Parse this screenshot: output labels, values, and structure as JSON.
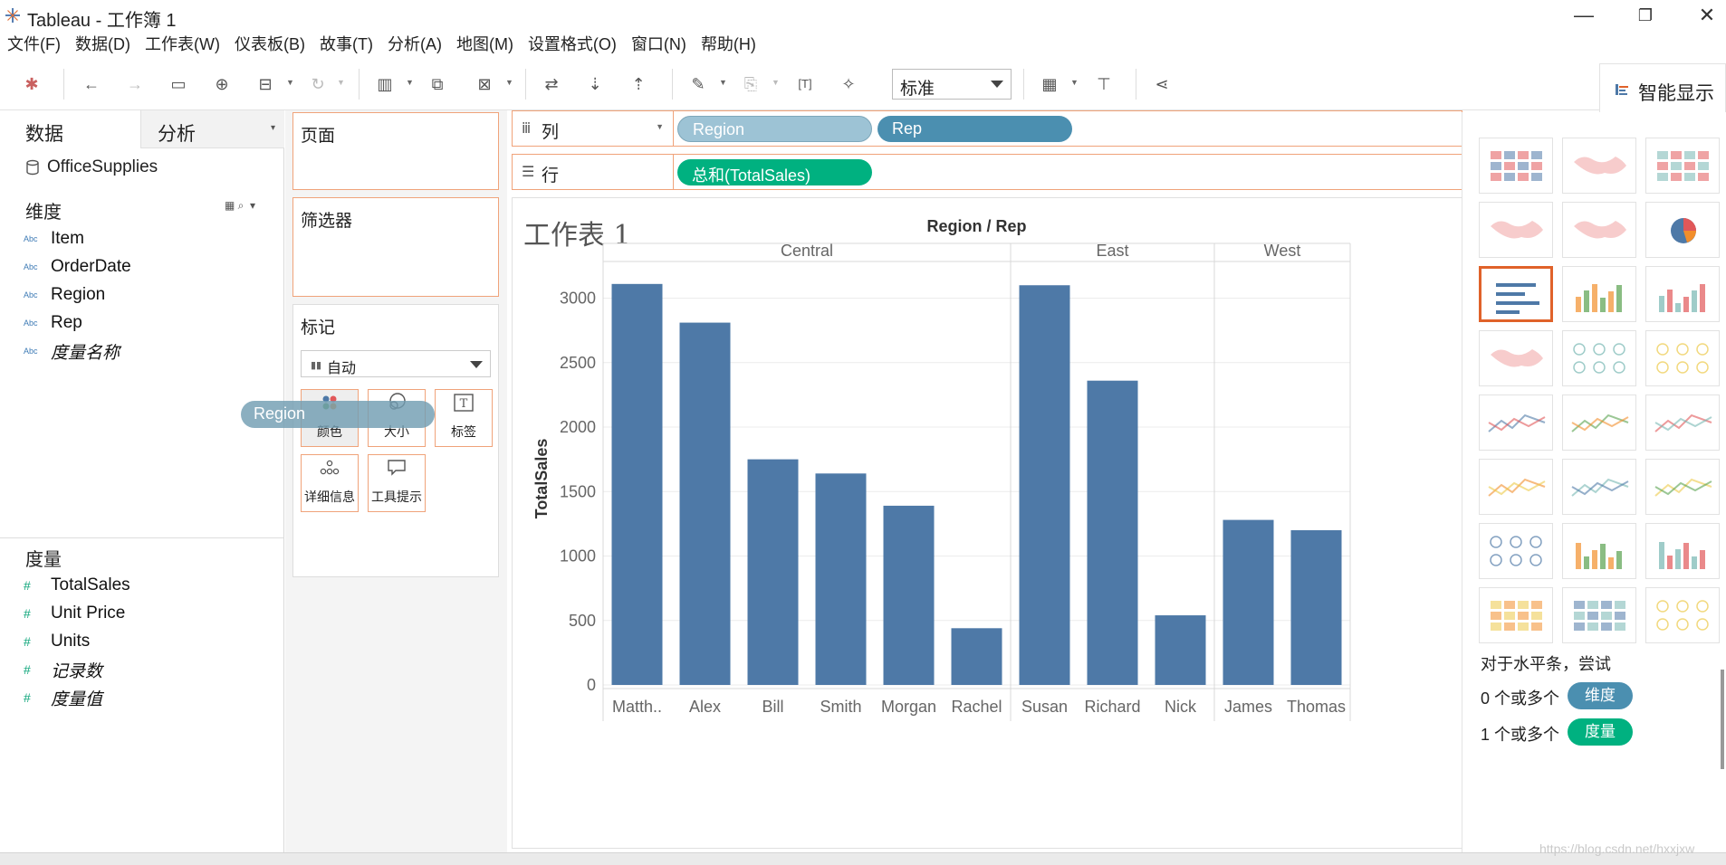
{
  "app": {
    "title": "Tableau - 工作簿 1",
    "window_controls": [
      "—",
      "❐",
      "✕"
    ]
  },
  "menu": [
    "文件(F)",
    "数据(D)",
    "工作表(W)",
    "仪表板(B)",
    "故事(T)",
    "分析(A)",
    "地图(M)",
    "设置格式(O)",
    "窗口(N)",
    "帮助(H)"
  ],
  "toolbar": {
    "fit_select": "标准",
    "smart_show_label": "智能显示"
  },
  "data_pane": {
    "tabs": [
      "数据",
      "分析"
    ],
    "datasource": "OfficeSupplies",
    "dimensions_title": "维度",
    "dimensions": [
      {
        "type": "Abc",
        "name": "Item",
        "italic": false
      },
      {
        "type": "Abc",
        "name": "OrderDate",
        "italic": false
      },
      {
        "type": "Abc",
        "name": "Region",
        "italic": false
      },
      {
        "type": "Abc",
        "name": "Rep",
        "italic": false
      },
      {
        "type": "Abc",
        "name": "度量名称",
        "italic": true
      }
    ],
    "measures_title": "度量",
    "measures": [
      {
        "type": "#",
        "name": "TotalSales",
        "italic": false
      },
      {
        "type": "#",
        "name": "Unit Price",
        "italic": false
      },
      {
        "type": "#",
        "name": "Units",
        "italic": false
      },
      {
        "type": "#",
        "name": "记录数",
        "italic": true
      },
      {
        "type": "#",
        "name": "度量值",
        "italic": true
      }
    ]
  },
  "shelves": {
    "pages_title": "页面",
    "filters_title": "筛选器",
    "marks_title": "标记",
    "marks_type": "自动",
    "mark_buttons": [
      "颜色",
      "大小",
      "标签",
      "详细信息",
      "工具提示"
    ],
    "dragging_pill": "Region",
    "columns_label": "列",
    "rows_label": "行",
    "column_pills": [
      "Region",
      "Rep"
    ],
    "row_pills": [
      "总和(TotalSales)"
    ],
    "colors": {
      "region_pill": "#9dc3d5",
      "rep_pill": "#4b8fb0",
      "measure_pill": "#00b180",
      "accent_border": "#f0a37a"
    }
  },
  "worksheet": {
    "title": "工作表 1"
  },
  "chart_data": {
    "type": "bar",
    "title": "Region / Rep",
    "ylabel": "TotalSales",
    "ylim": [
      0,
      3200
    ],
    "yticks": [
      0,
      500,
      1000,
      1500,
      2000,
      2500,
      3000
    ],
    "bar_color": "#4e79a7",
    "grid": true,
    "groups": [
      {
        "region": "Central",
        "reps": [
          "Matth..",
          "Alex",
          "Bill",
          "Smith",
          "Morgan",
          "Rachel"
        ],
        "values": [
          3110,
          2810,
          1750,
          1640,
          1390,
          440
        ]
      },
      {
        "region": "East",
        "reps": [
          "Susan",
          "Richard",
          "Nick"
        ],
        "values": [
          3100,
          2360,
          540
        ]
      },
      {
        "region": "West",
        "reps": [
          "James",
          "Thomas"
        ],
        "values": [
          1280,
          1200
        ]
      }
    ]
  },
  "smart_show": {
    "hint": "对于水平条，尝试",
    "dim_req": "0 个或多个",
    "dim_badge": "维度",
    "meas_req": "1 个或多个",
    "meas_badge": "度量",
    "selected_index": 6,
    "thumbs": [
      "text-table",
      "heat-map",
      "highlight-table",
      "symbol-map",
      "filled-map",
      "pie-chart",
      "horizontal-bars",
      "stacked-bars",
      "side-by-side-bars",
      "treemap",
      "circle-views",
      "side-by-side-circles",
      "continuous-lines",
      "discrete-lines",
      "dual-lines",
      "area-continuous",
      "area-discrete",
      "dual-combination",
      "scatter-plot",
      "histogram",
      "box-whisker",
      "gantt-chart",
      "bullet-graph",
      "packed-bubbles"
    ]
  },
  "watermark": "https://blog.csdn.net/hxxjxw"
}
